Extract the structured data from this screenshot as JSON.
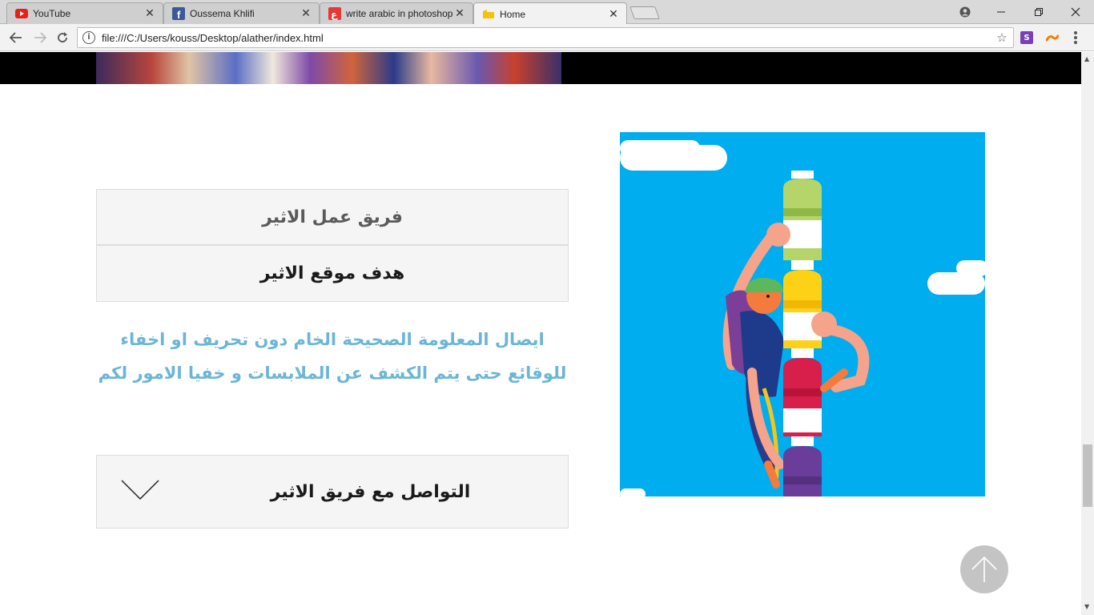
{
  "browser": {
    "tabs": [
      {
        "title": "YouTube",
        "icon": "youtube-icon",
        "active": false
      },
      {
        "title": "Oussema Khlifi",
        "icon": "facebook-icon",
        "active": false
      },
      {
        "title": "write arabic in photoshop",
        "icon": "arabic-font-site-icon",
        "active": false
      },
      {
        "title": "Home",
        "icon": "folder-icon",
        "active": true
      }
    ],
    "url": "file:///C:/Users/kouss/Desktop/alather/index.html"
  },
  "page": {
    "team_panel_title": "فريق عمل الاثير",
    "goal_panel_title": "هدف موقع الاثير",
    "goal_text_line1": "ايصال المعلومة الصحيحة الخام دون تحريف او اخفاء",
    "goal_text_line2": "للوقائع حتى يتم الكشف عن الملابسات و خفيا الامور لكم",
    "contact_panel_title": "التواصل مع فريق الاثير",
    "colors": {
      "accent_text": "#6bb6d6",
      "illustration_sky": "#00adef",
      "panel_bg": "#f5f5f5"
    }
  }
}
